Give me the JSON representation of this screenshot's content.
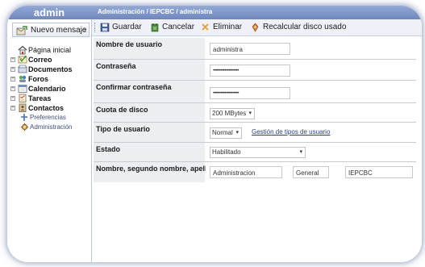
{
  "sidebar": {
    "title": "admin",
    "new_message": "Nuevo mensaje",
    "new_message_arrow": "›",
    "items": [
      {
        "label": "Página inicial",
        "icon": "home-icon",
        "expander": ""
      },
      {
        "label": "Correo",
        "icon": "mail-icon",
        "expander": "+"
      },
      {
        "label": "Documentos",
        "icon": "documents-icon",
        "expander": "+"
      },
      {
        "label": "Foros",
        "icon": "forums-icon",
        "expander": "+"
      },
      {
        "label": "Calendario",
        "icon": "calendar-icon",
        "expander": "+"
      },
      {
        "label": "Tareas",
        "icon": "tasks-icon",
        "expander": "+"
      },
      {
        "label": "Contactos",
        "icon": "contacts-icon",
        "expander": "+"
      },
      {
        "label": "Preferencias",
        "icon": "preferences-icon",
        "expander": ""
      },
      {
        "label": "Administración",
        "icon": "admin-icon",
        "expander": ""
      }
    ]
  },
  "header": {
    "breadcrumb": "Administración / IEPCBC / administra"
  },
  "toolbar": {
    "save": "Guardar",
    "cancel": "Cancelar",
    "delete": "Eliminar",
    "recalc": "Recalcular disco usado"
  },
  "form": {
    "username_label": "Nombre de usuario",
    "username_value": "administra",
    "password_label": "Contraseña",
    "password_value": "••••••••••••••••••••",
    "confirm_label": "Confirmar contraseña",
    "confirm_value": "••••••••••••••••••••",
    "quota_label": "Cuota de disco",
    "quota_value": "200 MBytes",
    "usertype_label": "Tipo de usuario",
    "usertype_value": "Normal",
    "usertype_link": "Gestión de tipos de usuario",
    "status_label": "Estado",
    "status_value": "Habilitado",
    "name_label": "Nombre, segundo nombre, apellido",
    "first_name": "Administracion",
    "middle_name": "General",
    "last_name": "IEPCBC"
  },
  "colors": {
    "titlebar": "#7b93c9",
    "label_bg": "#eceef2",
    "link": "#2a3f7a"
  }
}
